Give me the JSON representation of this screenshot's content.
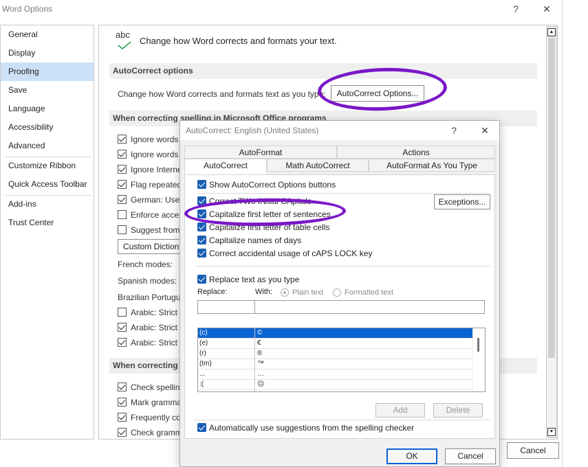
{
  "word_options": {
    "title": "Word Options",
    "help": "?",
    "close": "✕",
    "nav": [
      "General",
      "Display",
      "Proofing",
      "Save",
      "Language",
      "Accessibility",
      "Advanced",
      "Customize Ribbon",
      "Quick Access Toolbar",
      "Add-ins",
      "Trust Center"
    ],
    "selected_nav": "Proofing",
    "header_icon_text": "abc",
    "header_text": "Change how Word corrects and formats your text.",
    "autocorrect_section": "AutoCorrect options",
    "autocorrect_desc": "Change how Word corrects and formats text as you type:",
    "autocorrect_button": "AutoCorrect Options...",
    "spelling_section": "When correcting spelling in Microsoft Office programs",
    "spelling_options": [
      {
        "label": "Ignore words",
        "checked": true
      },
      {
        "label": "Ignore words",
        "checked": true
      },
      {
        "label": "Ignore Interne",
        "checked": true
      },
      {
        "label": "Flag repeated",
        "checked": true
      },
      {
        "label": "German: Use",
        "checked": true
      },
      {
        "label": "Enforce accen",
        "checked": false
      },
      {
        "label": "Suggest from",
        "checked": false
      }
    ],
    "custom_dict_button": "Custom Diction",
    "french_modes": "French modes:",
    "spanish_modes": "Spanish modes:",
    "brazilian": "Brazilian Portugu",
    "arabic_options": [
      {
        "label": "Arabic: Strict",
        "checked": false
      },
      {
        "label": "Arabic: Strict",
        "checked": true
      },
      {
        "label": "Arabic: Strict",
        "checked": true
      }
    ],
    "correcting_section": "When correcting",
    "correcting_options": [
      {
        "label": "Check spellin",
        "checked": true
      },
      {
        "label": "Mark gramma",
        "checked": true
      },
      {
        "label": "Frequently co",
        "checked": true
      },
      {
        "label": "Check gramm",
        "checked": true
      }
    ],
    "cancel_button": "Cancel"
  },
  "autocorrect_dialog": {
    "title": "AutoCorrect: English (United States)",
    "help": "?",
    "close": "✕",
    "tabs_top": [
      "AutoFormat",
      "Actions"
    ],
    "tabs_bottom": [
      "AutoCorrect",
      "Math AutoCorrect",
      "AutoFormat As You Type"
    ],
    "selected_tab": "AutoCorrect",
    "show_buttons": "Show AutoCorrect Options buttons",
    "options": [
      "Correct TWo INitial CApitals",
      "Capitalize first letter of sentences",
      "Capitalize first letter of table cells",
      "Capitalize names of days",
      "Correct accidental usage of cAPS LOCK key"
    ],
    "exceptions_button": "Exceptions...",
    "replace_text": "Replace text as you type",
    "replace_label": "Replace:",
    "with_label": "With:",
    "plain_text": "Plain text",
    "formatted_text": "Formatted text",
    "entries": [
      {
        "from": "(c)",
        "to": "©"
      },
      {
        "from": "(e)",
        "to": "€"
      },
      {
        "from": "(r)",
        "to": "®"
      },
      {
        "from": "(tm)",
        "to": "™"
      },
      {
        "from": "...",
        "to": "…"
      },
      {
        "from": ":(",
        "to": "☹"
      }
    ],
    "add_button": "Add",
    "delete_button": "Delete",
    "auto_suggest": "Automatically use suggestions from the spelling checker",
    "ok_button": "OK",
    "cancel_button": "Cancel"
  },
  "colors": {
    "selection": "#0a64d2",
    "nav_selected": "#cce0f7",
    "highlighter": "#7a18c8"
  }
}
